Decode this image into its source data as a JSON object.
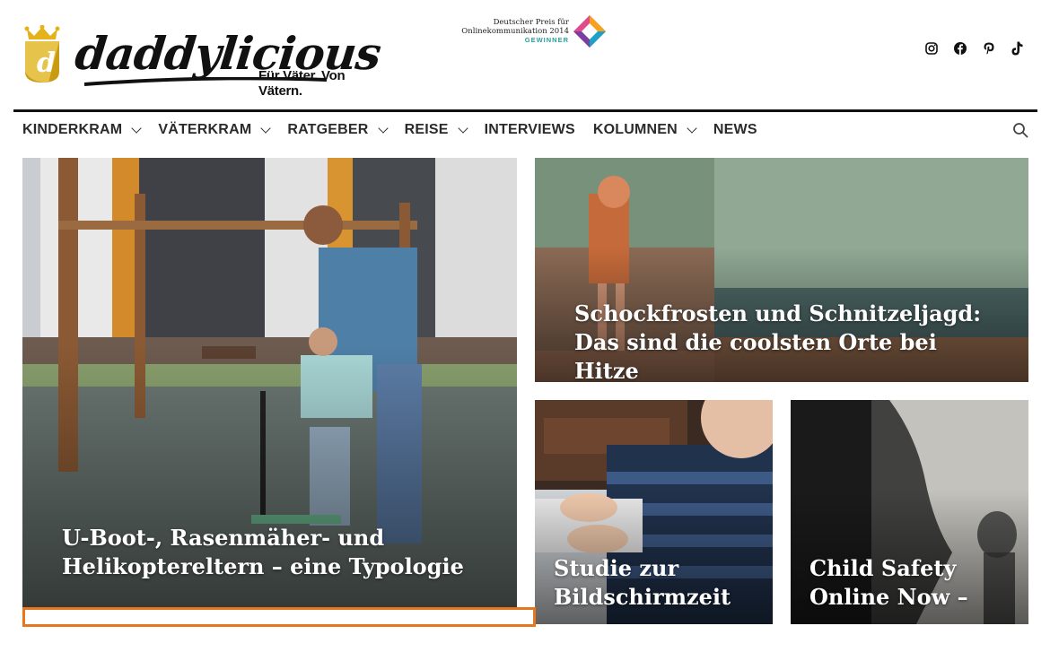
{
  "header": {
    "logo_word": "daddylicious",
    "logo_tagline": "Für Väter. Von Vätern.",
    "award": {
      "line1": "Deutscher Preis für",
      "line2": "Onlinekommunikation 2014",
      "line3": "GEWINNER"
    },
    "social_icons": [
      "instagram-icon",
      "facebook-icon",
      "pinterest-icon",
      "tiktok-icon"
    ]
  },
  "nav": {
    "items": [
      {
        "label": "KINDERKRAM",
        "dropdown": true
      },
      {
        "label": "VÄTERKRAM",
        "dropdown": true
      },
      {
        "label": "RATGEBER",
        "dropdown": true
      },
      {
        "label": "REISE",
        "dropdown": true
      },
      {
        "label": "INTERVIEWS",
        "dropdown": false
      },
      {
        "label": "KOLUMNEN",
        "dropdown": true
      },
      {
        "label": "NEWS",
        "dropdown": false
      }
    ]
  },
  "featured": {
    "main": {
      "title": "U-Boot-, Rasenmäher- und Helikoptereltern – eine Typologie"
    },
    "top_right": {
      "title": "Schockfrosten und Schnitzeljagd: Das sind die coolsten Orte bei Hitze"
    },
    "bottom_left": {
      "title": "Studie zur Bildschirmzeit"
    },
    "bottom_right": {
      "title": "Child Safety Online Now –"
    }
  },
  "colors": {
    "accent": "#e8761d",
    "nav_text": "#2b2b2b",
    "crown_gold": "#d4a514"
  }
}
